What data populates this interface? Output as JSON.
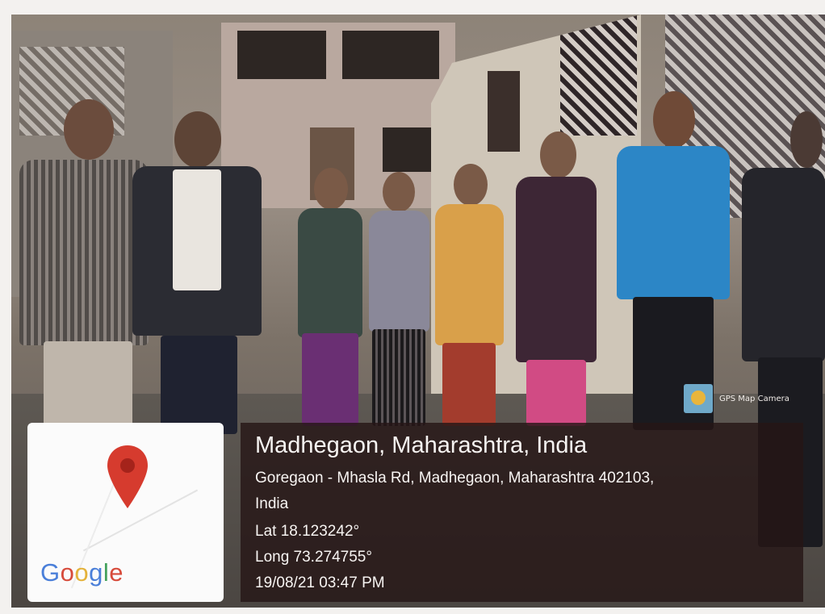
{
  "overlay": {
    "city_line": "Madhegaon, Maharashtra, India",
    "address_line1": "Goregaon - Mhasla Rd, Madhegaon, Maharashtra 402103,",
    "address_line2": "India",
    "latitude": "Lat 18.123242°",
    "longitude": "Long 73.274755°",
    "datetime": "19/08/21 03:47 PM",
    "badge_label": "GPS Map Camera",
    "map_logo": "Google"
  },
  "colors": {
    "google_letters": [
      "#4a7fd9",
      "#d74b3b",
      "#e4b23a",
      "#4a7fd9",
      "#43a15b",
      "#d74b3b"
    ],
    "pin": "#d63b2e"
  }
}
